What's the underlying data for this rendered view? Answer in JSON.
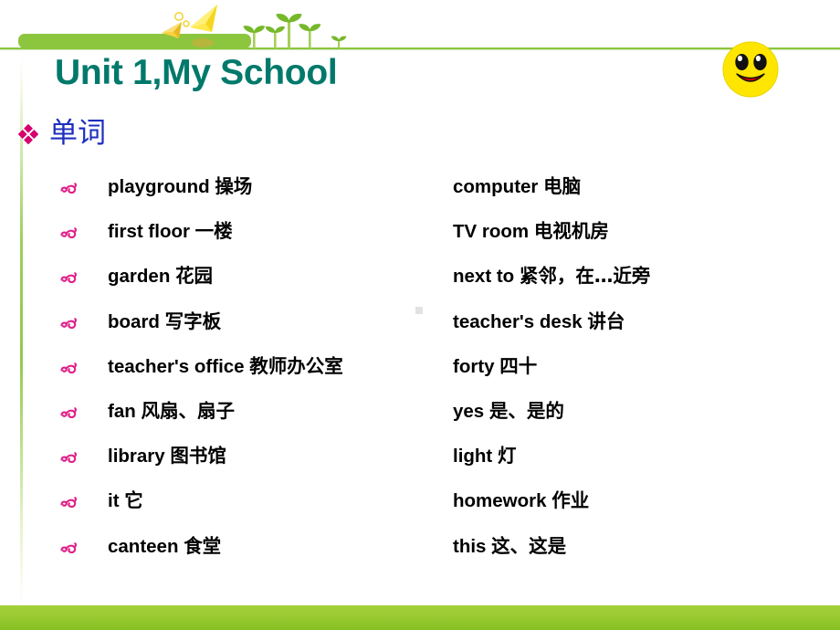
{
  "slide": {
    "title": "Unit 1,My School",
    "section_heading": "单词",
    "colors": {
      "title": "#00796b",
      "section_heading": "#1d2fbe",
      "accent_green": "#8cc63f",
      "bottom_bar": "#9bcb32",
      "bullet_pink": "#e0218a",
      "smiley_face": "#ffe600",
      "smiley_mouth": "#cc0000"
    }
  },
  "decorations": {
    "paper_plane_large": "paper-plane-icon",
    "paper_plane_small": "paper-plane-icon",
    "sprouts": "sprout-icon",
    "smiley": "smiley-face-icon",
    "section_bullet": "diamond-cluster-bullet-icon",
    "row_bullet": "swirl-flourish-bullet-icon"
  },
  "word_list": [
    {
      "left_en": "playground",
      "left_cn": "操场",
      "right_en": "computer",
      "right_cn": "电脑"
    },
    {
      "left_en": "first  floor",
      "left_cn": "一楼",
      "right_en": "TV room",
      "right_cn": "电视机房"
    },
    {
      "left_en": "garden",
      "left_cn": "花园",
      "right_en": "next to",
      "right_cn": "紧邻，在…近旁"
    },
    {
      "left_en": "board",
      "left_cn": "写字板",
      "right_en": "teacher's desk",
      "right_cn": "讲台"
    },
    {
      "left_en": "teacher's office",
      "left_cn": "教师办公室",
      "right_en": " forty",
      "right_cn": " 四十"
    },
    {
      "left_en": "fan",
      "left_cn": "风扇、扇子",
      "right_en": " yes",
      "right_cn": "是、是的"
    },
    {
      "left_en": "library",
      "left_cn": "图书馆",
      "right_en": "light",
      "right_cn": "灯"
    },
    {
      "left_en": "it",
      "left_cn": "它",
      "right_en": "homework",
      "right_cn": "作业"
    },
    {
      "left_en": "canteen",
      "left_cn": "食堂",
      "right_en": " this",
      "right_cn": "这、这是"
    }
  ]
}
